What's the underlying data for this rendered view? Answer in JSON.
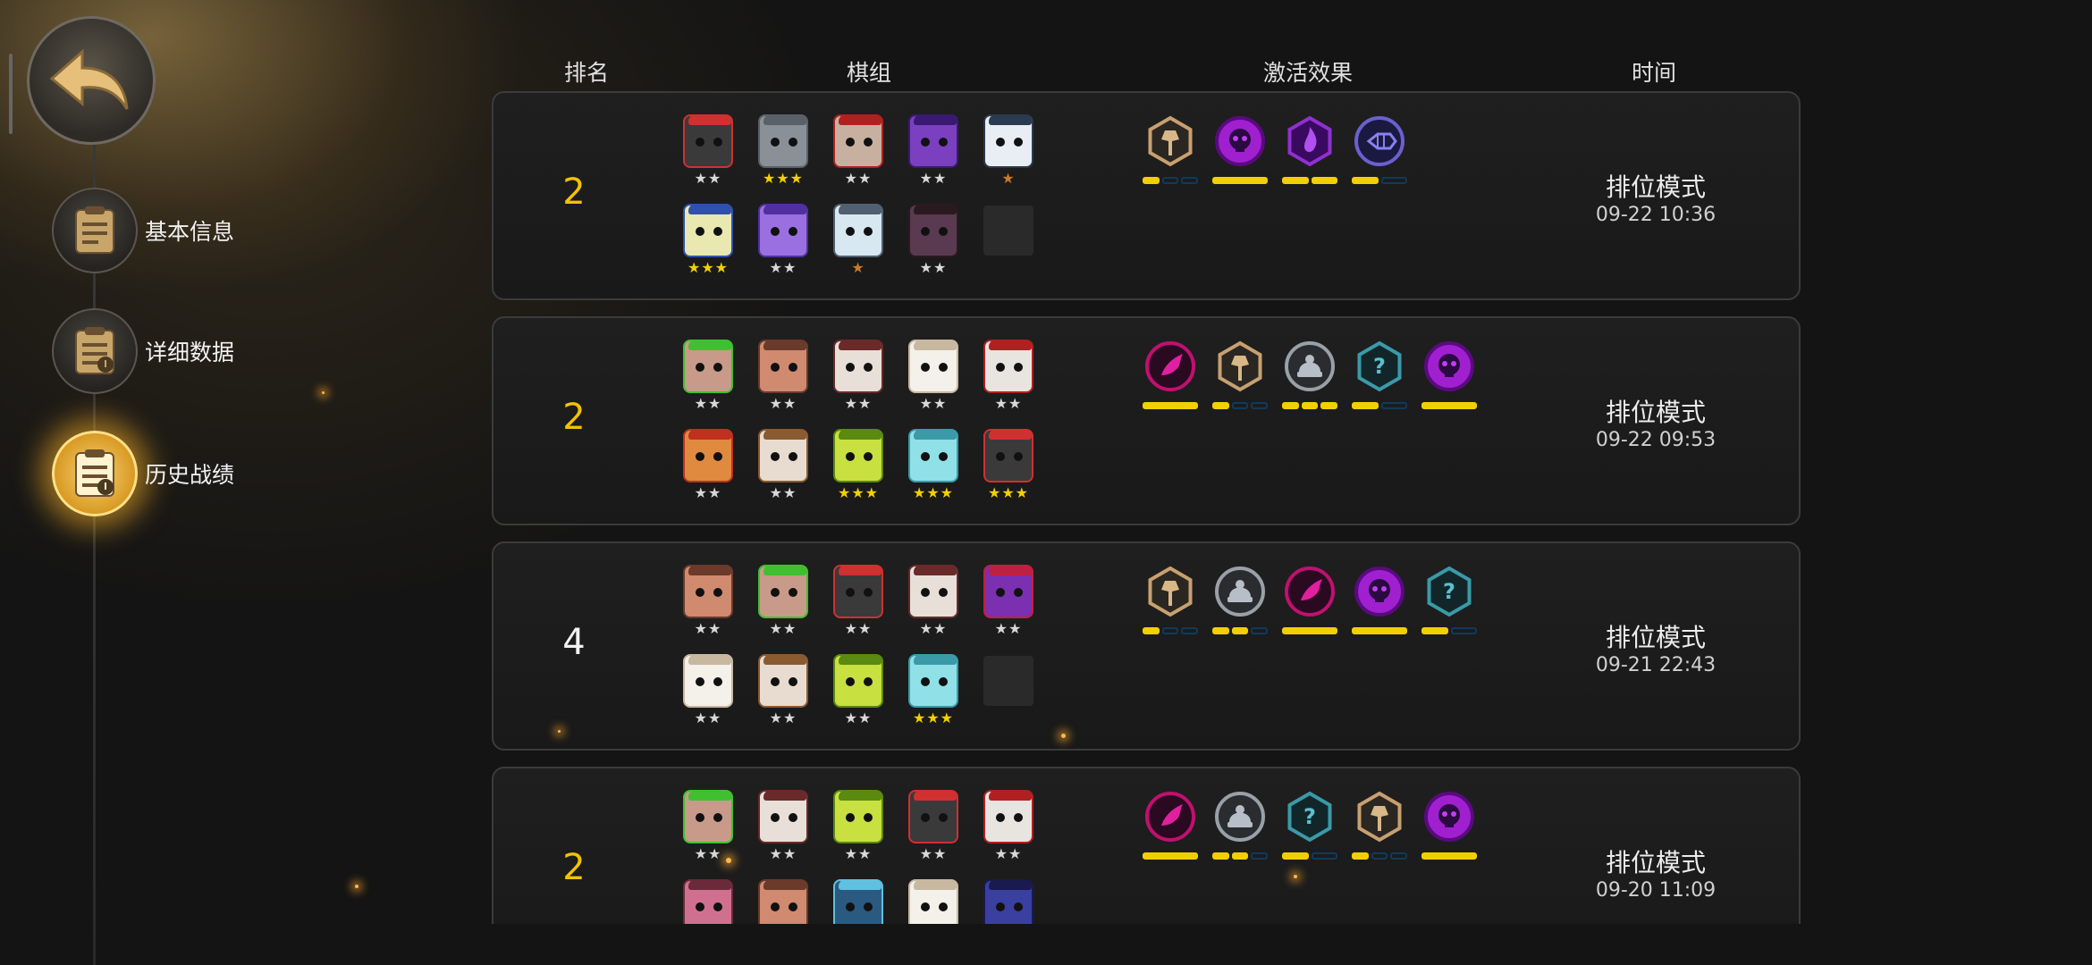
{
  "sidebar": {
    "items": [
      {
        "label": "基本信息",
        "icon": "clipboard-icon"
      },
      {
        "label": "详细数据",
        "icon": "info-clipboard-icon"
      },
      {
        "label": "历史战绩",
        "icon": "history-clipboard-icon"
      }
    ],
    "active_index": 2
  },
  "headers": {
    "rank": "排名",
    "lineup": "棋组",
    "traits": "激活效果",
    "time": "时间"
  },
  "matches": [
    {
      "rank": "2",
      "mode": "排位模式",
      "time": "09-22 10:36",
      "pieces": [
        {
          "name": "red-hat-bearded-piece",
          "stars": "★★",
          "star_color": "#d8d8d8"
        },
        {
          "name": "gray-knight-piece",
          "stars": "★★★",
          "star_color": "#f2d000"
        },
        {
          "name": "horned-red-piece",
          "stars": "★★",
          "star_color": "#d8d8d8"
        },
        {
          "name": "purple-hooded-piece",
          "stars": "★★",
          "star_color": "#d8d8d8"
        },
        {
          "name": "white-hooded-piece",
          "stars": "★",
          "star_color": "#c87a2a"
        },
        {
          "name": "blue-hat-duck-piece",
          "stars": "★★★",
          "star_color": "#f2d000"
        },
        {
          "name": "purple-robot-piece",
          "stars": "★★",
          "star_color": "#d8d8d8"
        },
        {
          "name": "egg-piece",
          "stars": "★",
          "star_color": "#c87a2a"
        },
        {
          "name": "dark-masked-piece",
          "stars": "★★",
          "star_color": "#d8d8d8"
        },
        {
          "name": "empty-slot",
          "stars": "",
          "star_color": "#d8d8d8"
        }
      ],
      "traits": [
        {
          "name": "axe-trait-icon",
          "active": 1,
          "total": 3
        },
        {
          "name": "demon-trait-icon",
          "active": 1,
          "total": 1
        },
        {
          "name": "spirit-trait-icon",
          "active": 2,
          "total": 2
        },
        {
          "name": "fish-trait-icon",
          "active": 1,
          "total": 2
        }
      ]
    },
    {
      "rank": "2",
      "mode": "排位模式",
      "time": "09-22 09:53",
      "pieces": [
        {
          "name": "green-horn-piece",
          "stars": "★★",
          "star_color": "#d8d8d8"
        },
        {
          "name": "pig-warrior-piece",
          "stars": "★★",
          "star_color": "#d8d8d8"
        },
        {
          "name": "white-beast-piece",
          "stars": "★★",
          "star_color": "#d8d8d8"
        },
        {
          "name": "white-sheep-piece",
          "stars": "★★",
          "star_color": "#d8d8d8"
        },
        {
          "name": "red-skull-piece",
          "stars": "★★",
          "star_color": "#d8d8d8"
        },
        {
          "name": "red-hat-girl-piece",
          "stars": "★★",
          "star_color": "#d8d8d8"
        },
        {
          "name": "hooded-elder-piece",
          "stars": "★★",
          "star_color": "#d8d8d8"
        },
        {
          "name": "green-lizard-piece",
          "stars": "★★★",
          "star_color": "#f2d000"
        },
        {
          "name": "ice-troll-piece",
          "stars": "★★★",
          "star_color": "#f2d000"
        },
        {
          "name": "red-hat-bearded-piece",
          "stars": "★★★",
          "star_color": "#f2d000"
        }
      ],
      "traits": [
        {
          "name": "wing-trait-icon",
          "active": 1,
          "total": 1
        },
        {
          "name": "axe-trait-icon",
          "active": 1,
          "total": 3
        },
        {
          "name": "warrior-trait-icon",
          "active": 3,
          "total": 3
        },
        {
          "name": "mystic-trait-icon",
          "active": 1,
          "total": 2
        },
        {
          "name": "demon-trait-icon",
          "active": 1,
          "total": 1
        }
      ]
    },
    {
      "rank": "4",
      "mode": "排位模式",
      "time": "09-21 22:43",
      "pieces": [
        {
          "name": "pig-warrior-piece",
          "stars": "★★",
          "star_color": "#d8d8d8"
        },
        {
          "name": "green-horn-piece",
          "stars": "★★",
          "star_color": "#d8d8d8"
        },
        {
          "name": "red-hat-bearded-piece",
          "stars": "★★",
          "star_color": "#d8d8d8"
        },
        {
          "name": "white-beast-piece",
          "stars": "★★",
          "star_color": "#d8d8d8"
        },
        {
          "name": "purple-demon-piece",
          "stars": "★★",
          "star_color": "#d8d8d8"
        },
        {
          "name": "white-sheep-piece",
          "stars": "★★",
          "star_color": "#d8d8d8"
        },
        {
          "name": "hooded-elder-piece",
          "stars": "★★",
          "star_color": "#d8d8d8"
        },
        {
          "name": "green-lizard-piece",
          "stars": "★★",
          "star_color": "#d8d8d8"
        },
        {
          "name": "ice-troll-piece",
          "stars": "★★★",
          "star_color": "#f2d000"
        },
        {
          "name": "empty-slot",
          "stars": "",
          "star_color": "#d8d8d8"
        }
      ],
      "traits": [
        {
          "name": "axe-trait-icon",
          "active": 1,
          "total": 3
        },
        {
          "name": "warrior-trait-icon",
          "active": 2,
          "total": 3
        },
        {
          "name": "wing-trait-icon",
          "active": 1,
          "total": 1
        },
        {
          "name": "demon-trait-icon",
          "active": 1,
          "total": 1
        },
        {
          "name": "mystic-trait-icon",
          "active": 1,
          "total": 2
        }
      ]
    },
    {
      "rank": "2",
      "mode": "排位模式",
      "time": "09-20 11:09",
      "pieces": [
        {
          "name": "green-horn-piece",
          "stars": "★★",
          "star_color": "#d8d8d8"
        },
        {
          "name": "white-beast-piece",
          "stars": "★★",
          "star_color": "#d8d8d8"
        },
        {
          "name": "green-lizard-piece",
          "stars": "★★",
          "star_color": "#d8d8d8"
        },
        {
          "name": "red-hat-bearded-piece",
          "stars": "★★",
          "star_color": "#d8d8d8"
        },
        {
          "name": "red-skull-piece",
          "stars": "★★",
          "star_color": "#d8d8d8"
        },
        {
          "name": "pink-ogre-piece",
          "stars": "",
          "star_color": "#d8d8d8"
        },
        {
          "name": "pig-warrior-piece",
          "stars": "",
          "star_color": "#d8d8d8"
        },
        {
          "name": "blue-robot-piece",
          "stars": "",
          "star_color": "#d8d8d8"
        },
        {
          "name": "white-sheep-piece",
          "stars": "",
          "star_color": "#d8d8d8"
        },
        {
          "name": "blue-hooded-piece",
          "stars": "",
          "star_color": "#d8d8d8"
        }
      ],
      "traits": [
        {
          "name": "wing-trait-icon",
          "active": 1,
          "total": 1
        },
        {
          "name": "warrior-trait-icon",
          "active": 2,
          "total": 3
        },
        {
          "name": "mystic-trait-icon",
          "active": 1,
          "total": 2
        },
        {
          "name": "axe-trait-icon",
          "active": 1,
          "total": 3
        },
        {
          "name": "demon-trait-icon",
          "active": 1,
          "total": 1
        }
      ]
    }
  ],
  "colors": {
    "rank_gold": "#f2c200",
    "rank_white": "#f2f2f2",
    "bar_on": "#f2d000",
    "bar_off": "#0f3a5c",
    "gold_trait_ring": "#c8a070",
    "purple_trait": "#a020d0",
    "magenta_trait": "#c01070",
    "gray_trait": "#9aa0a8",
    "teal_trait": "#3a9aa8"
  }
}
